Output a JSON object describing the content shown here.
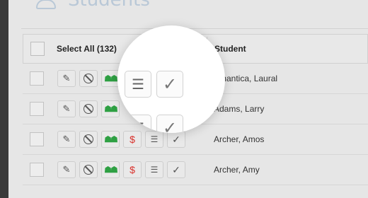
{
  "header": {
    "title": "Students",
    "icon": "user-icon"
  },
  "table": {
    "select_all_label": "Select All (132)",
    "student_column": "Student",
    "rows": [
      {
        "name": "Amantica, Laural"
      },
      {
        "name": "Adams, Larry"
      },
      {
        "name": "Archer, Amos"
      },
      {
        "name": "Archer, Amy"
      }
    ]
  },
  "actions": {
    "edit_icon": "pencil-icon",
    "block_icon": "block-icon",
    "group_icon": "group-icon",
    "fee_icon": "dollar-icon",
    "list_icon": "list-icon",
    "check_icon": "check-icon",
    "group_color": "#2ea043",
    "fee_color": "#d9312c"
  }
}
